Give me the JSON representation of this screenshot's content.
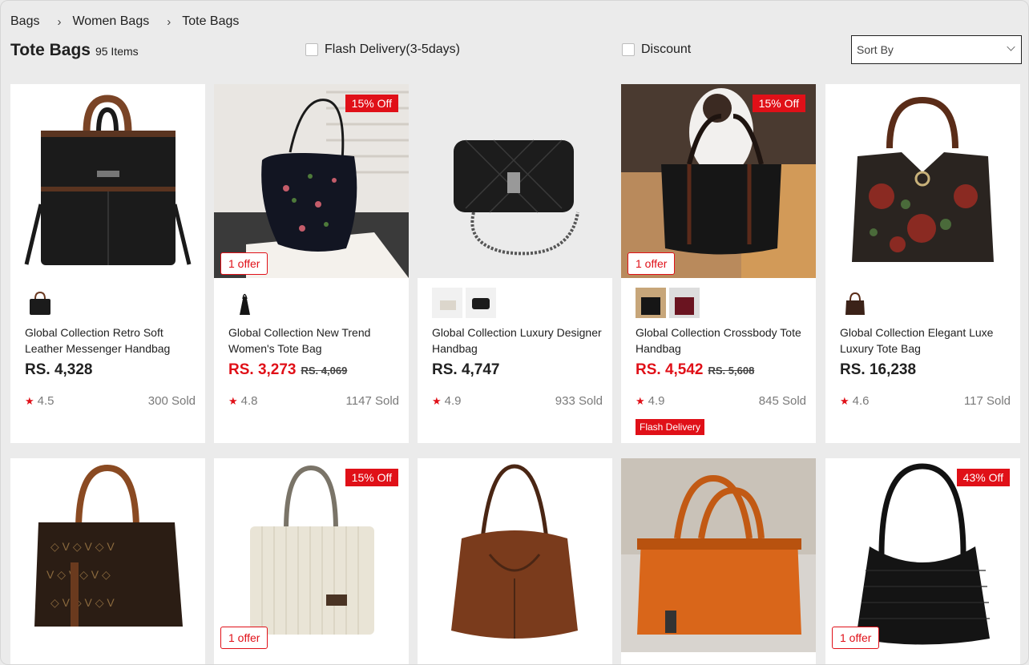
{
  "breadcrumb": {
    "items": [
      "Bags",
      "Women Bags",
      "Tote Bags"
    ],
    "separator": "›"
  },
  "header": {
    "title": "Tote Bags",
    "count": "95 Items"
  },
  "filters": {
    "flash_delivery": "Flash Delivery(3-5days)",
    "discount": "Discount"
  },
  "sort": {
    "label": "Sort By"
  },
  "colors": {
    "accent": "#e01018",
    "page_bg": "#ebebeb"
  },
  "products": [
    {
      "name": "Global Collection  Retro Soft Leather Messenger Handbag",
      "price": "RS. 4,328",
      "old_price": "",
      "rating": "4.5",
      "sold": "300 Sold",
      "off": "",
      "offer": "",
      "flash": ""
    },
    {
      "name": "Global Collection  New Trend Women's Tote Bag",
      "price": "RS. 3,273",
      "old_price": "RS. 4,069",
      "rating": "4.8",
      "sold": "1147 Sold",
      "off": "15% Off",
      "offer": "1 offer",
      "flash": ""
    },
    {
      "name": "Global Collection  Luxury Designer Handbag",
      "price": "RS. 4,747",
      "old_price": "",
      "rating": "4.9",
      "sold": "933 Sold",
      "off": "",
      "offer": "",
      "flash": ""
    },
    {
      "name": "Global Collection  Crossbody Tote Handbag",
      "price": "RS. 4,542",
      "old_price": "RS. 5,608",
      "rating": "4.9",
      "sold": "845 Sold",
      "off": "15% Off",
      "offer": "1 offer",
      "flash": "Flash Delivery"
    },
    {
      "name": "Global Collection  Elegant Luxe Luxury Tote Bag",
      "price": "RS. 16,238",
      "old_price": "",
      "rating": "4.6",
      "sold": "117 Sold",
      "off": "",
      "offer": "",
      "flash": ""
    },
    {
      "off": ""
    },
    {
      "off": "15% Off",
      "offer": "1 offer"
    },
    {
      "off": ""
    },
    {
      "off": ""
    },
    {
      "off": "43% Off",
      "offer": "1 offer"
    }
  ]
}
